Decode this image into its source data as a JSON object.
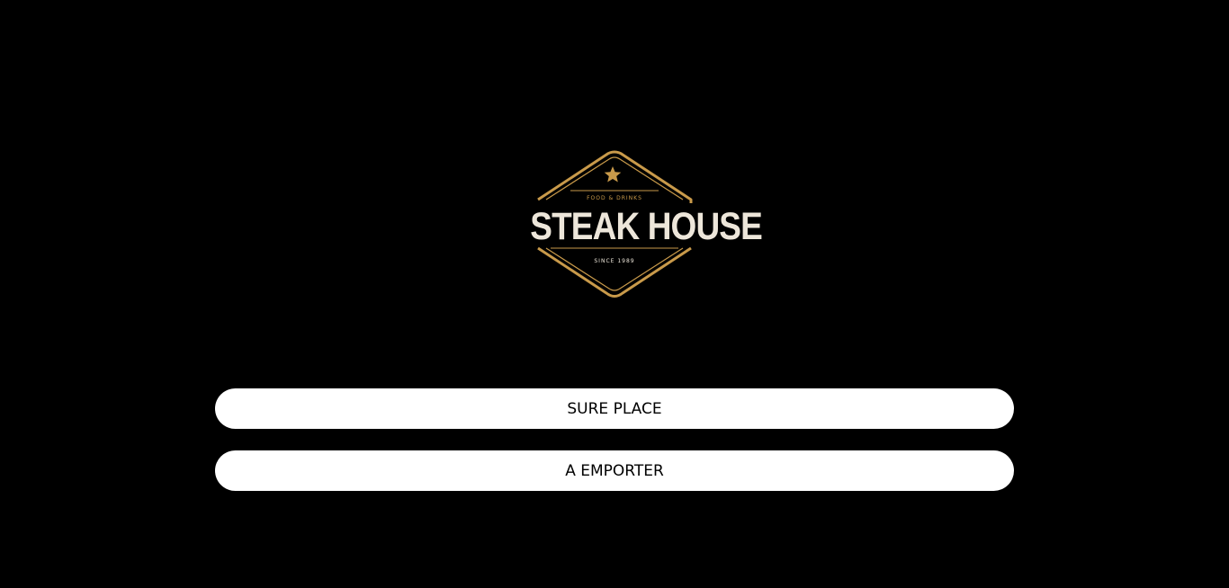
{
  "logo": {
    "title": "STEAK HOUSE",
    "tagline": "FOOD & DRINKS",
    "since": "SINCE 1989",
    "accent_color": "#c99a4a",
    "text_color": "#ede6da",
    "icon": "star-icon"
  },
  "actions": {
    "dine_in_label": "SURE PLACE",
    "takeaway_label": "A EMPORTER"
  },
  "colors": {
    "background": "#000000",
    "button_bg": "#ffffff",
    "button_text": "#000000"
  }
}
